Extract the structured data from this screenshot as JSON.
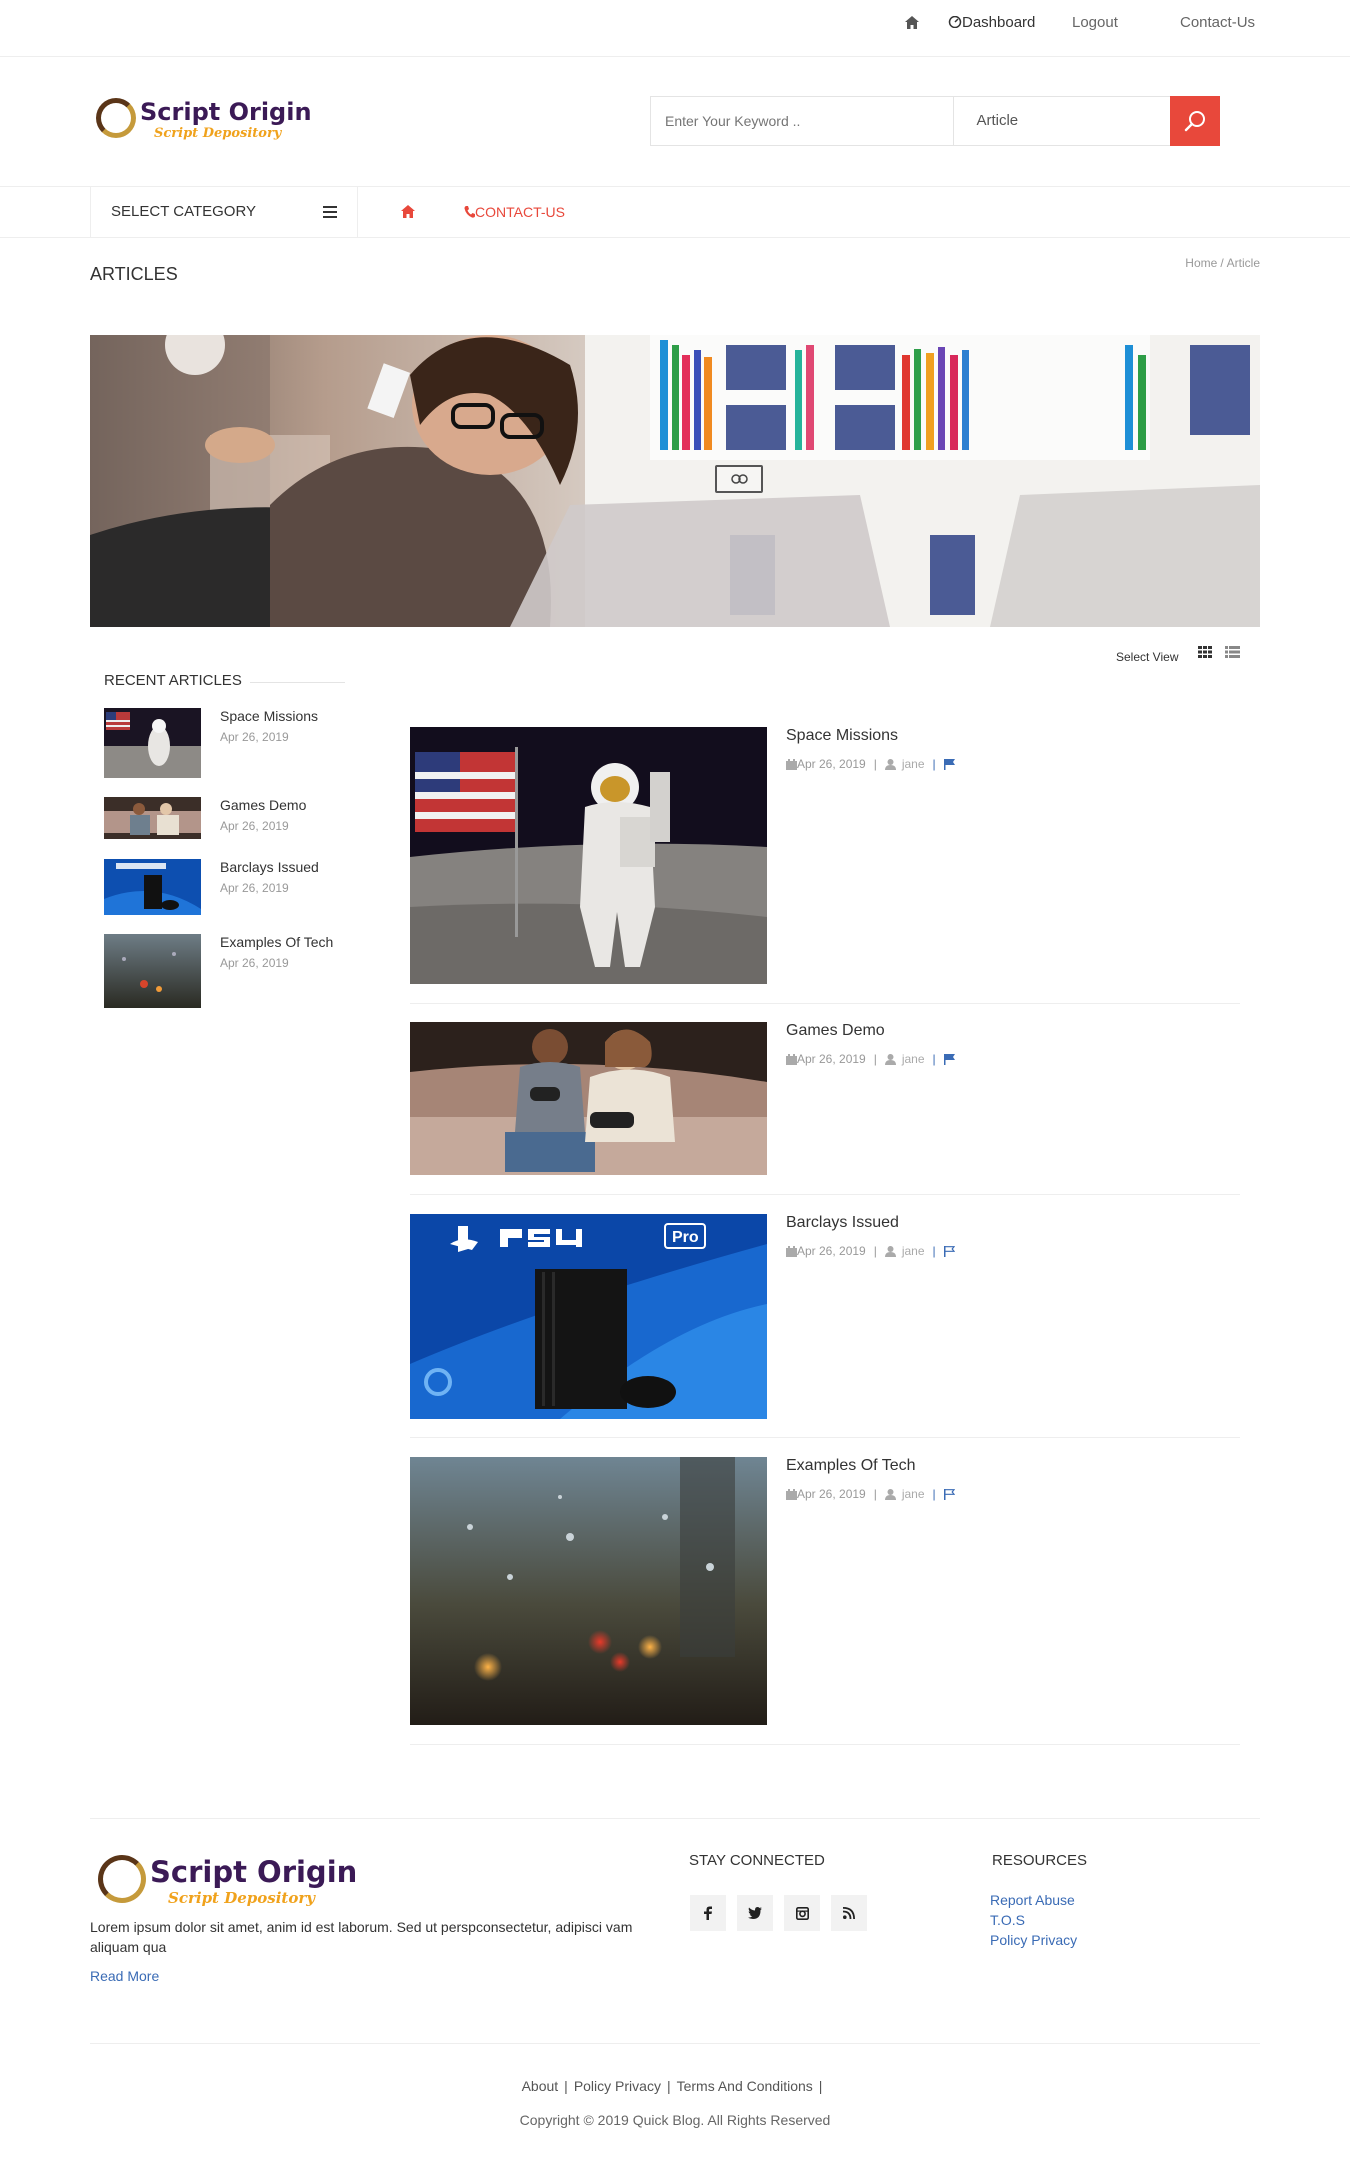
{
  "topbar": {
    "home_icon": "home-icon",
    "dashboard": "Dashboard",
    "logout": "Logout",
    "contact": "Contact-Us"
  },
  "logo": {
    "line1": "Script Origin",
    "line2": "Script Depository"
  },
  "search": {
    "placeholder": "Enter Your Keyword ..",
    "type_selected": "Article",
    "button_icon": "search-icon"
  },
  "nav": {
    "category_label": "SELECT CATEGORY",
    "contact_label": "CONTACT-US"
  },
  "page": {
    "title": "ARTICLES",
    "breadcrumb": [
      "Home",
      "/",
      "Article"
    ]
  },
  "view": {
    "label": "Select View"
  },
  "sidebar": {
    "title": "RECENT ARTICLES",
    "items": [
      {
        "title": "Space Missions",
        "date": "Apr 26, 2019"
      },
      {
        "title": "Games Demo",
        "date": "Apr 26, 2019"
      },
      {
        "title": "Barclays Issued",
        "date": "Apr 26, 2019"
      },
      {
        "title": "Examples Of Tech",
        "date": "Apr 26, 2019"
      }
    ]
  },
  "articles": [
    {
      "title": "Space Missions",
      "date": "Apr 26, 2019",
      "author": "jane"
    },
    {
      "title": "Games Demo",
      "date": "Apr 26, 2019",
      "author": "jane"
    },
    {
      "title": "Barclays Issued",
      "date": "Apr 26, 2019",
      "author": "jane"
    },
    {
      "title": "Examples Of Tech",
      "date": "Apr 26, 2019",
      "author": "jane"
    }
  ],
  "footer": {
    "description": "Lorem ipsum dolor sit amet, anim id est laborum. Sed ut perspconsectetur, adipisci vam aliquam qua",
    "read_more": "Read More",
    "stay_connected": "STAY CONNECTED",
    "resources_title": "RESOURCES",
    "resources": [
      "Report Abuse",
      "T.O.S",
      "Policy Privacy"
    ],
    "bottom_links": [
      "About",
      "Policy Privacy",
      "Terms And Conditions"
    ],
    "copyright": "Copyright © 2019 Quick Blog. All Rights Reserved"
  },
  "colors": {
    "accent": "#e8483b",
    "link": "#3a6bb5",
    "logo_dark": "#3b1a56",
    "logo_gold": "#f0a21c"
  }
}
